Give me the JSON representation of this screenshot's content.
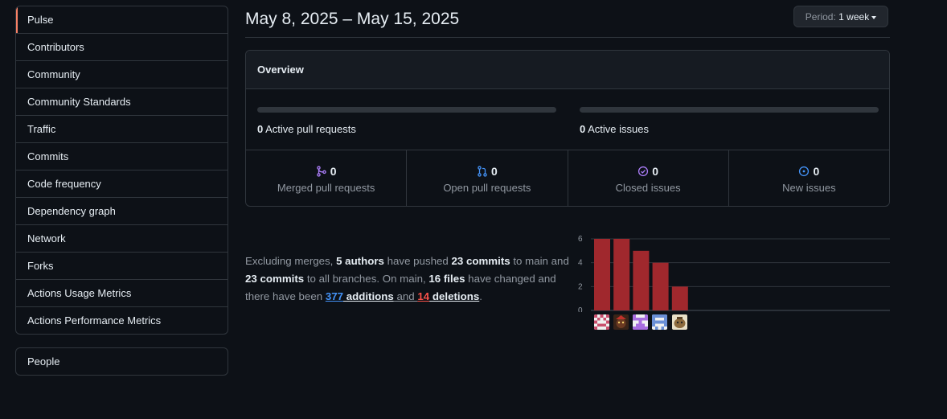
{
  "sidebar": {
    "items": [
      {
        "label": "Pulse"
      },
      {
        "label": "Contributors"
      },
      {
        "label": "Community"
      },
      {
        "label": "Community Standards"
      },
      {
        "label": "Traffic"
      },
      {
        "label": "Commits"
      },
      {
        "label": "Code frequency"
      },
      {
        "label": "Dependency graph"
      },
      {
        "label": "Network"
      },
      {
        "label": "Forks"
      },
      {
        "label": "Actions Usage Metrics"
      },
      {
        "label": "Actions Performance Metrics"
      }
    ],
    "selected": "Pulse",
    "people_label": "People"
  },
  "header": {
    "date_range": "May 8, 2025 – May 15, 2025",
    "period_label": "Period:",
    "period_value": "1 week"
  },
  "overview": {
    "title": "Overview",
    "active_prs": {
      "count": "0",
      "label": "Active pull requests",
      "progress": 0
    },
    "active_issues": {
      "count": "0",
      "label": "Active issues",
      "progress": 0
    },
    "stats": [
      {
        "count": "0",
        "label": "Merged pull requests",
        "icon": "git-merge-icon",
        "color": "#ab7df8"
      },
      {
        "count": "0",
        "label": "Open pull requests",
        "icon": "git-pull-request-icon",
        "color": "#4493f8"
      },
      {
        "count": "0",
        "label": "Closed issues",
        "icon": "issue-closed-icon",
        "color": "#ab7df8"
      },
      {
        "count": "0",
        "label": "New issues",
        "icon": "issue-opened-icon",
        "color": "#4493f8"
      }
    ]
  },
  "summary": {
    "t1": "Excluding merges, ",
    "authors": "5 authors",
    "t2": " have pushed ",
    "commits_main": "23 commits",
    "t3": " to main and ",
    "commits_all": "23 commits",
    "t4": " to all branches. On main, ",
    "files": "16 files",
    "t5": " have changed and there have been ",
    "additions_num": "377",
    "additions_word": " additions",
    "t6": " and ",
    "deletions_num": "14",
    "deletions_word": " deletions",
    "t7": "."
  },
  "chart_data": {
    "type": "bar",
    "values": [
      6,
      6,
      5,
      4,
      2
    ],
    "y_ticks": [
      "0",
      "2",
      "4",
      "6"
    ],
    "ylim": [
      0,
      6
    ],
    "bar_color": "#a0282d",
    "grid": true
  }
}
